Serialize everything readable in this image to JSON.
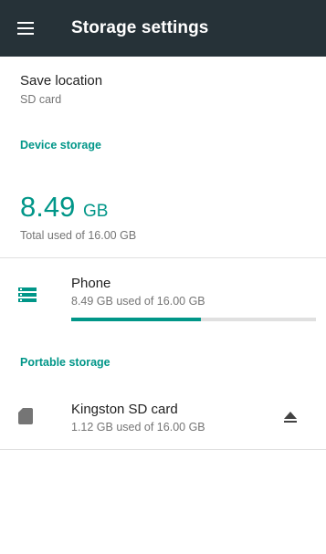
{
  "toolbar": {
    "title": "Storage settings",
    "menu_icon": "menu-icon",
    "background": "#263238"
  },
  "save_location": {
    "title": "Save location",
    "value": "SD card"
  },
  "device_storage": {
    "header": "Device storage",
    "total_value": "8.49",
    "total_unit": "GB",
    "total_caption": "Total used of 16.00 GB",
    "volumes": [
      {
        "name": "Phone",
        "summary": "8.49 GB used of 16.00 GB",
        "icon": "storage-icon",
        "used_fraction": 0.53
      }
    ]
  },
  "portable_storage": {
    "header": "Portable storage",
    "volumes": [
      {
        "name": "Kingston SD card",
        "summary": "1.12 GB used of 16.00 GB",
        "icon": "sd-card-icon",
        "action_icon": "eject-icon"
      }
    ]
  },
  "colors": {
    "accent": "#009688",
    "primary_text": "#212121",
    "secondary_text": "#757575",
    "divider": "#e0e0e0"
  }
}
